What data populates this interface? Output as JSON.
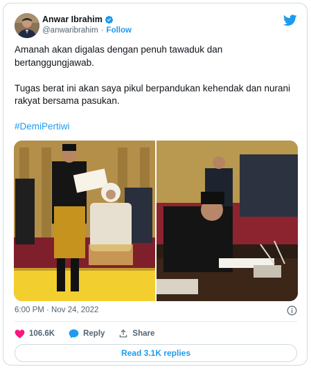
{
  "author": {
    "name": "Anwar Ibrahim",
    "handle": "@anwaribrahim",
    "separator": "·",
    "follow_label": "Follow"
  },
  "tweet": {
    "paragraph_1": "Amanah akan digalas dengan penuh tawaduk dan bertanggungjawab.",
    "paragraph_2": "Tugas berat ini akan saya pikul berpandukan kehendak dan nurani rakyat bersama pasukan.",
    "hashtag": "#DemiPertiwi"
  },
  "timestamp": "6:00 PM · Nov 24, 2022",
  "actions": {
    "like_count": "106.6K",
    "reply_label": "Reply",
    "share_label": "Share"
  },
  "read_replies_label": "Read 3.1K replies",
  "colors": {
    "accent": "#1d9bf0",
    "like": "#f91880",
    "text": "#0f1419",
    "muted": "#536471"
  },
  "icons": [
    "verified-badge-icon",
    "twitter-bird-icon",
    "info-icon",
    "heart-icon",
    "reply-bubble-icon",
    "share-icon"
  ]
}
